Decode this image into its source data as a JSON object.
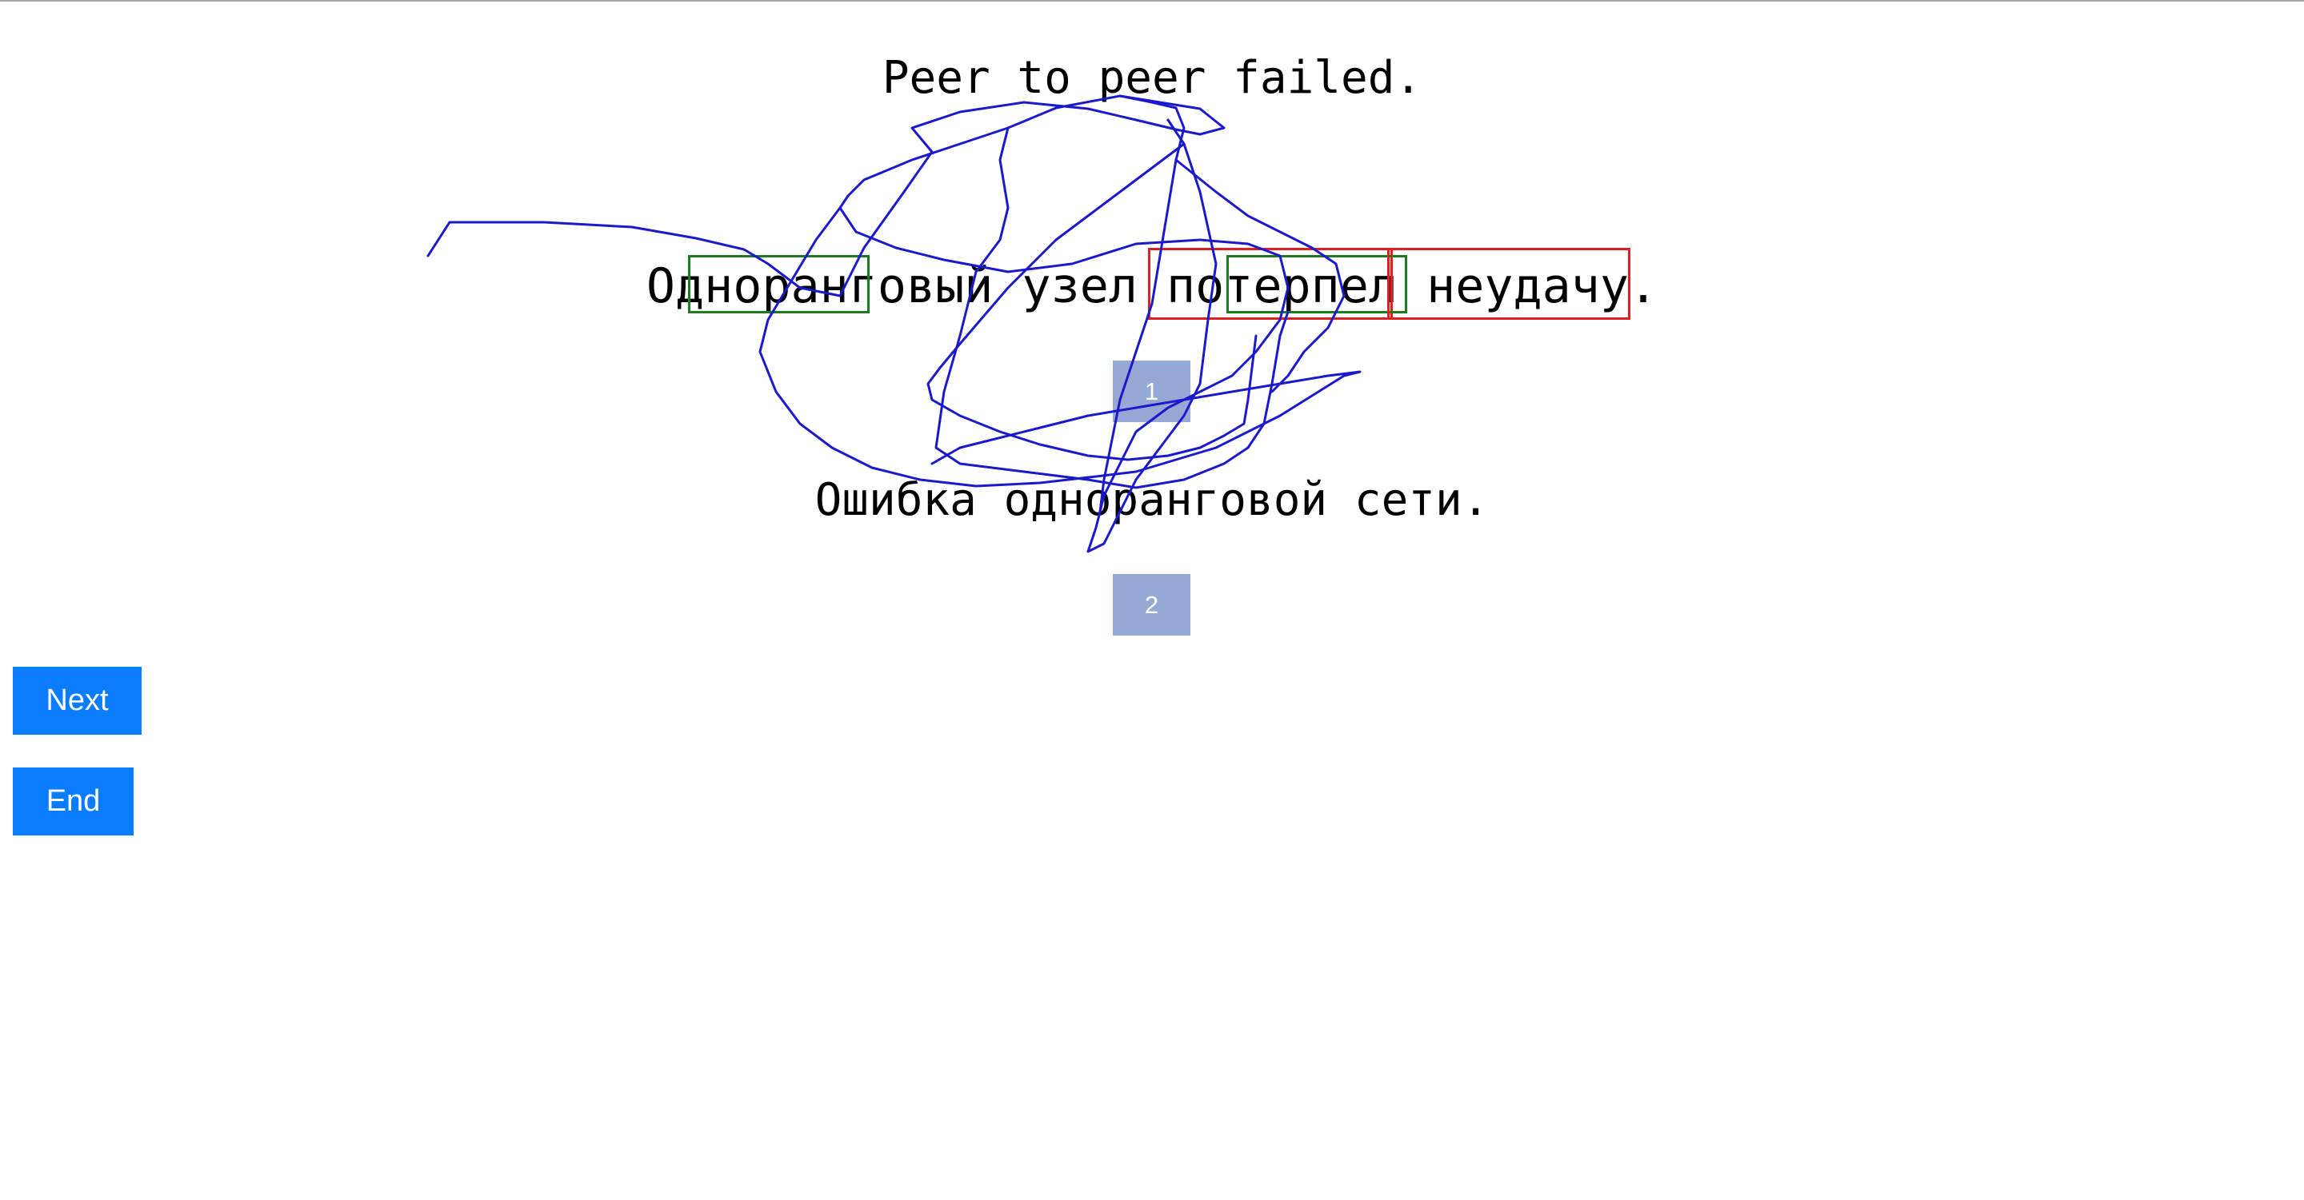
{
  "source_text": "Peer to peer failed.",
  "machine_translation": "Одноранговый узел потерпел неудачу.",
  "reference_translation": "Ошибка одноранговой сети.",
  "badges": [
    "1",
    "2"
  ],
  "buttons": {
    "next": "Next",
    "end": "End"
  },
  "colors": {
    "button": "#0a7cff",
    "badge": "#94a9d4",
    "good_box": "#1f7a1f",
    "bad_box": "#e02020",
    "scribble": "#1a1acc"
  }
}
